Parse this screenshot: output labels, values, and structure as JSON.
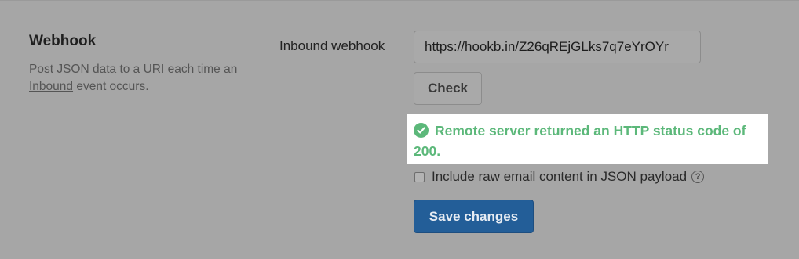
{
  "section": {
    "title": "Webhook",
    "description_prefix": "Post JSON data to a URI each time an ",
    "description_link": "Inbound",
    "description_suffix": " event occurs."
  },
  "webhook": {
    "label": "Inbound webhook",
    "url_value": "https://hookb.in/Z26qREjGLks7q7eYrOYr",
    "check_label": "Check"
  },
  "status": {
    "icon": "check-circle-icon",
    "message": "Remote server returned an HTTP status code of 200.",
    "color": "#5cb87a"
  },
  "raw_option": {
    "label": "Include raw email content in JSON payload",
    "checked": false,
    "help_glyph": "?"
  },
  "actions": {
    "save_label": "Save changes",
    "save_color": "#235e98"
  }
}
